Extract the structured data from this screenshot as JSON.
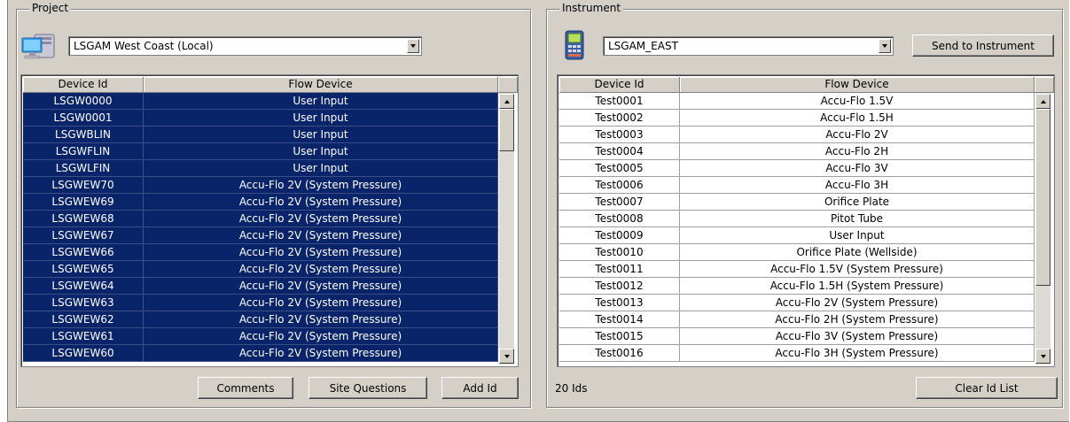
{
  "project": {
    "group_title": "Project",
    "icon": "computer-network-icon",
    "selected_project": "LSGAM West Coast (Local)",
    "columns": [
      "Device Id",
      "Flow Device"
    ],
    "rows": [
      {
        "id": "LSGW0000",
        "device": "User Input"
      },
      {
        "id": "LSGW0001",
        "device": "User Input"
      },
      {
        "id": "LSGWBLIN",
        "device": "User Input"
      },
      {
        "id": "LSGWFLIN",
        "device": "User Input"
      },
      {
        "id": "LSGWLFIN",
        "device": "User Input"
      },
      {
        "id": "LSGWEW70",
        "device": "Accu-Flo 2V (System Pressure)"
      },
      {
        "id": "LSGWEW69",
        "device": "Accu-Flo 2V (System Pressure)"
      },
      {
        "id": "LSGWEW68",
        "device": "Accu-Flo 2V (System Pressure)"
      },
      {
        "id": "LSGWEW67",
        "device": "Accu-Flo 2V (System Pressure)"
      },
      {
        "id": "LSGWEW66",
        "device": "Accu-Flo 2V (System Pressure)"
      },
      {
        "id": "LSGWEW65",
        "device": "Accu-Flo 2V (System Pressure)"
      },
      {
        "id": "LSGWEW64",
        "device": "Accu-Flo 2V (System Pressure)"
      },
      {
        "id": "LSGWEW63",
        "device": "Accu-Flo 2V (System Pressure)"
      },
      {
        "id": "LSGWEW62",
        "device": "Accu-Flo 2V (System Pressure)"
      },
      {
        "id": "LSGWEW61",
        "device": "Accu-Flo 2V (System Pressure)"
      },
      {
        "id": "LSGWEW60",
        "device": "Accu-Flo 2V (System Pressure)"
      }
    ],
    "buttons": {
      "comments": "Comments",
      "site_questions": "Site Questions",
      "add_id": "Add Id"
    },
    "colors": {
      "selection": "#0a246a"
    }
  },
  "instrument": {
    "group_title": "Instrument",
    "icon": "handheld-device-icon",
    "selected_instrument": "LSGAM_EAST",
    "send_button": "Send to Instrument",
    "columns": [
      "Device Id",
      "Flow Device"
    ],
    "rows": [
      {
        "id": "Test0001",
        "device": "Accu-Flo 1.5V"
      },
      {
        "id": "Test0002",
        "device": "Accu-Flo 1.5H"
      },
      {
        "id": "Test0003",
        "device": "Accu-Flo 2V"
      },
      {
        "id": "Test0004",
        "device": "Accu-Flo 2H"
      },
      {
        "id": "Test0005",
        "device": "Accu-Flo 3V"
      },
      {
        "id": "Test0006",
        "device": "Accu-Flo 3H"
      },
      {
        "id": "Test0007",
        "device": "Orifice Plate"
      },
      {
        "id": "Test0008",
        "device": "Pitot Tube"
      },
      {
        "id": "Test0009",
        "device": "User Input"
      },
      {
        "id": "Test0010",
        "device": "Orifice Plate (Wellside)"
      },
      {
        "id": "Test0011",
        "device": "Accu-Flo 1.5V (System Pressure)"
      },
      {
        "id": "Test0012",
        "device": "Accu-Flo 1.5H (System Pressure)"
      },
      {
        "id": "Test0013",
        "device": "Accu-Flo 2V (System Pressure)"
      },
      {
        "id": "Test0014",
        "device": "Accu-Flo 2H (System Pressure)"
      },
      {
        "id": "Test0015",
        "device": "Accu-Flo 3V (System Pressure)"
      },
      {
        "id": "Test0016",
        "device": "Accu-Flo 3H (System Pressure)"
      }
    ],
    "id_count": "20 Ids",
    "clear_button": "Clear Id List"
  }
}
